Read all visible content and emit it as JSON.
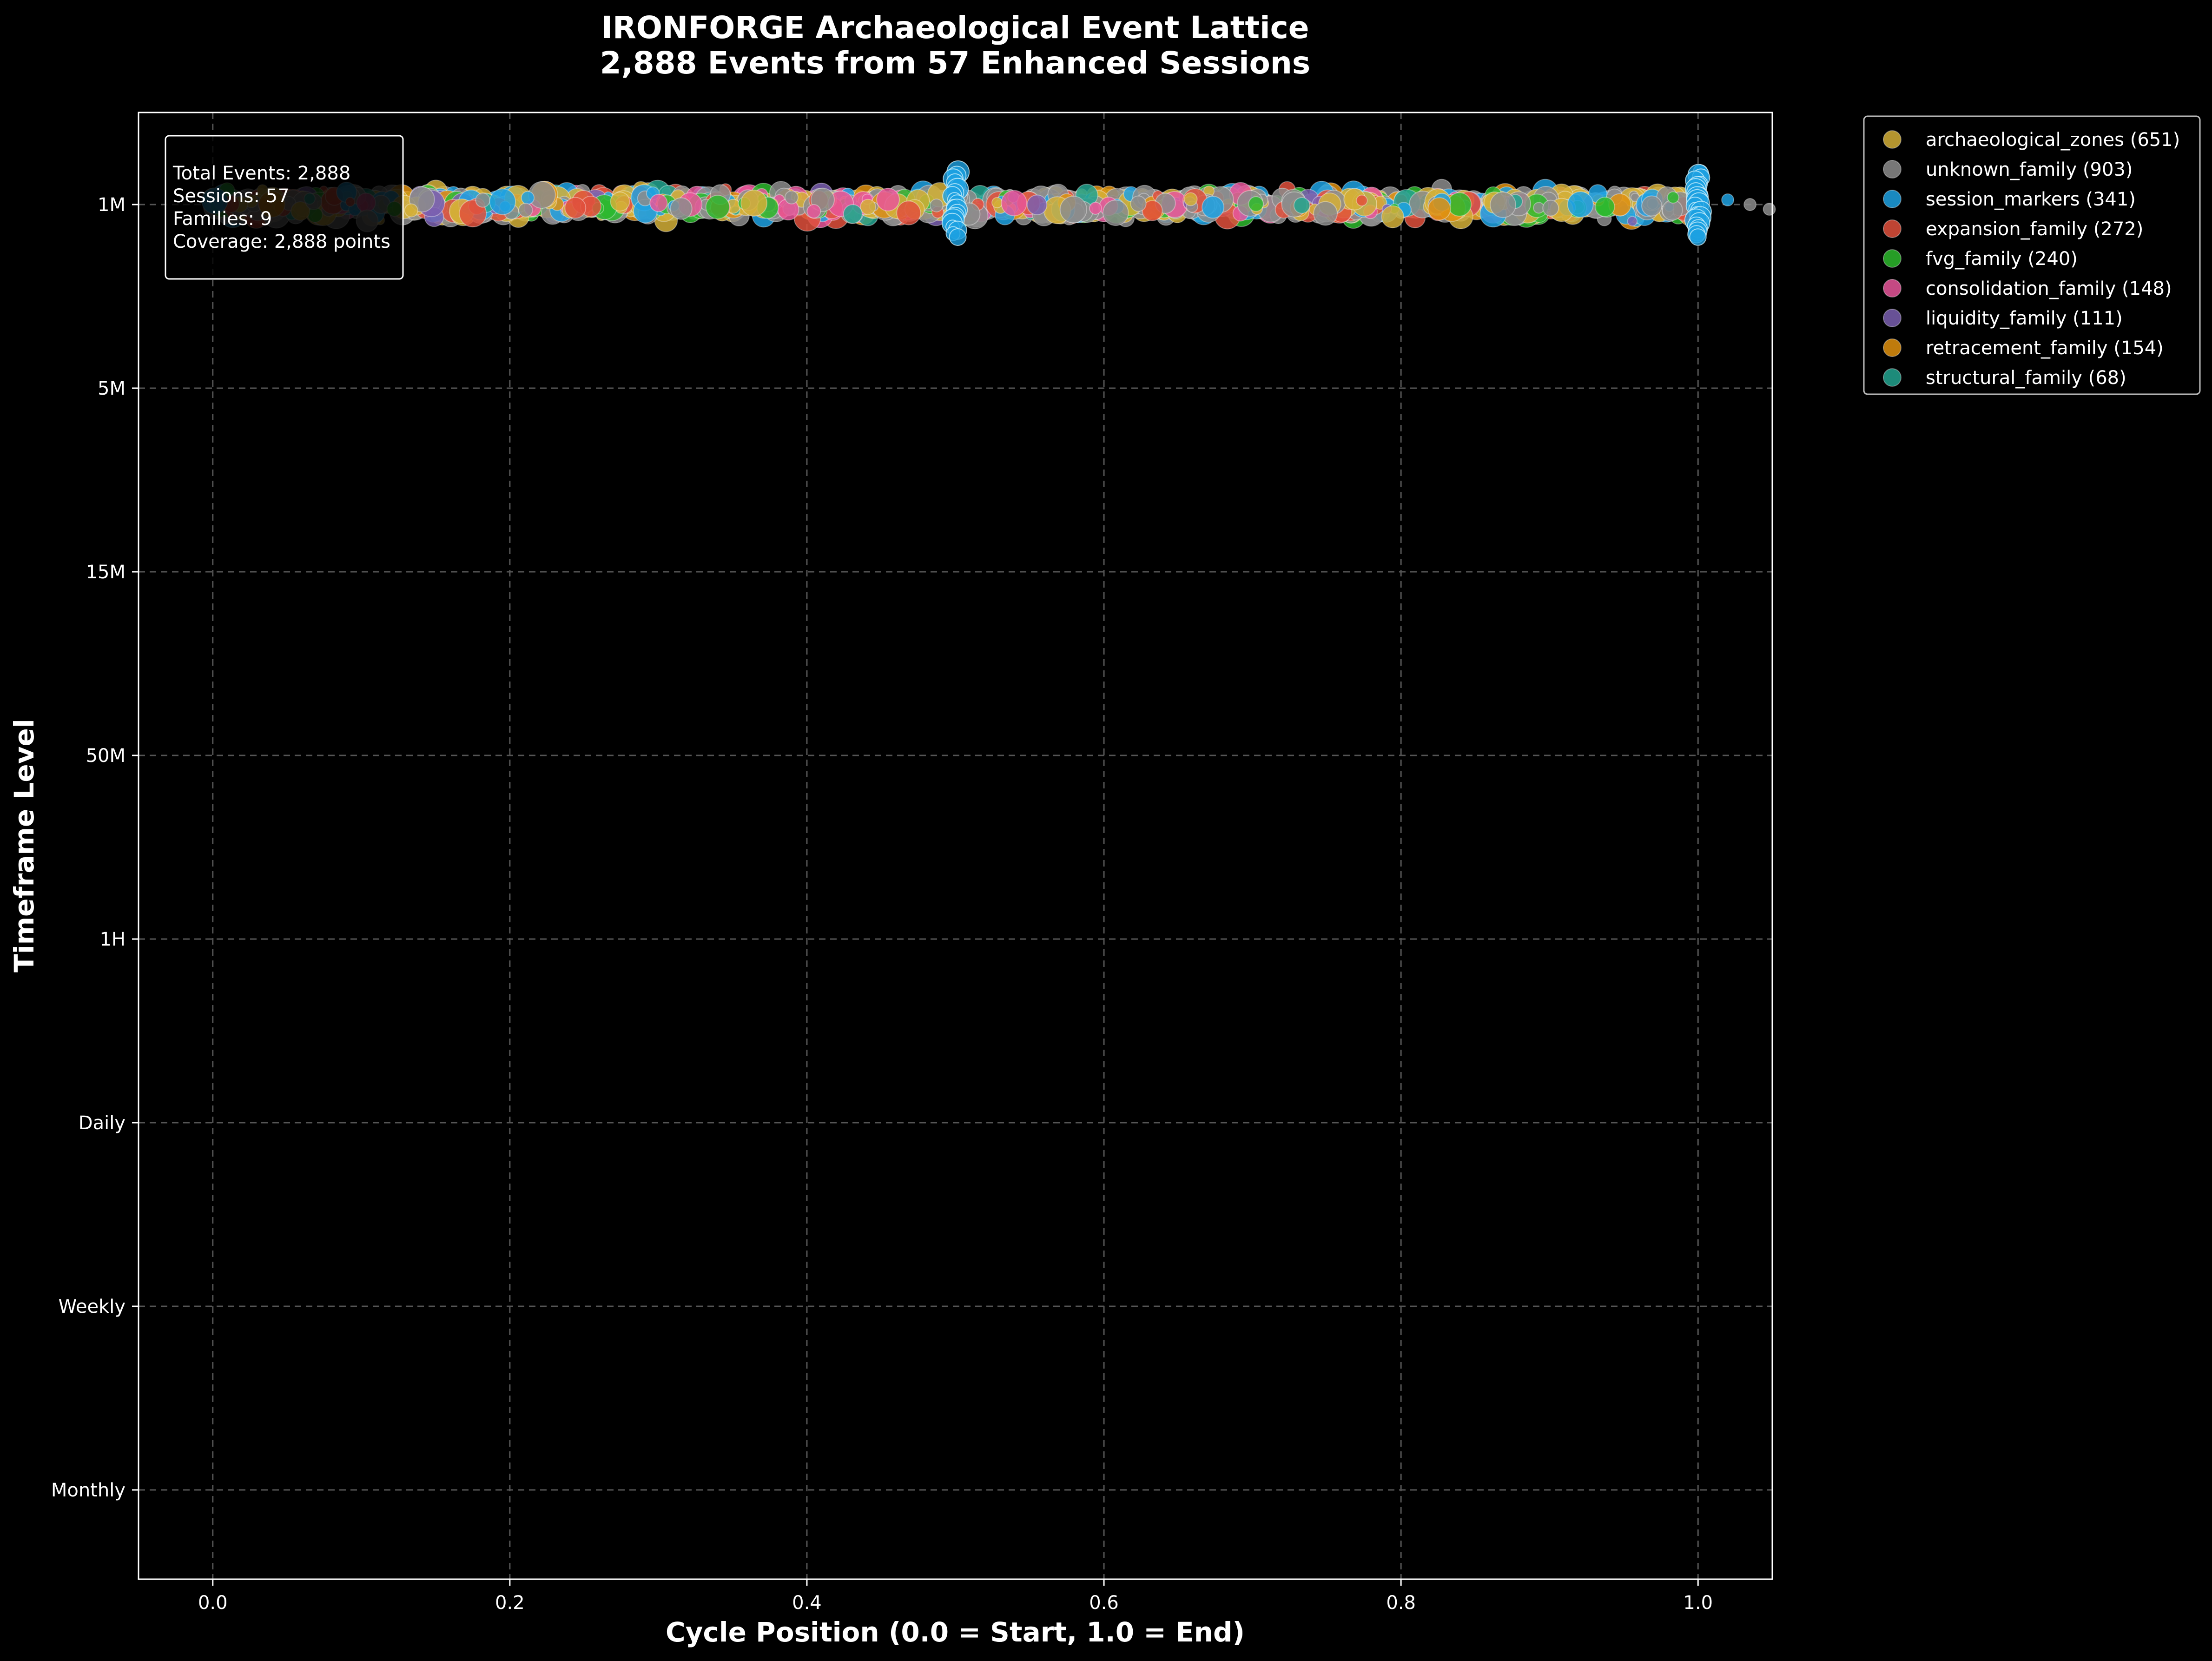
{
  "chart_data": {
    "type": "scatter",
    "title": "IRONFORGE Archaeological Event Lattice",
    "subtitle": "2,888 Events from 57 Enhanced Sessions",
    "xlabel": "Cycle Position (0.0 = Start, 1.0 = End)",
    "ylabel": "Timeframe Level",
    "xlim": [
      -0.05,
      1.05
    ],
    "x_ticks": [
      0.0,
      0.2,
      0.4,
      0.6,
      0.8,
      1.0
    ],
    "x_tick_labels": [
      "0.0",
      "0.2",
      "0.4",
      "0.6",
      "0.8",
      "1.0"
    ],
    "y_categories": [
      "1M",
      "5M",
      "15M",
      "50M",
      "1H",
      "Daily",
      "Weekly",
      "Monthly"
    ],
    "y_inverted": true,
    "grid": true,
    "legend_position": "outside-top-right",
    "info_box": {
      "lines": [
        "Total Events: 2,888",
        "Sessions: 57",
        "Families: 9",
        "Coverage: 2,888 points"
      ]
    },
    "series": [
      {
        "name": "archaeological_zones (651)",
        "count": 651,
        "color": "#d4af37"
      },
      {
        "name": "unknown_family (903)",
        "count": 903,
        "color": "#8c8c8c"
      },
      {
        "name": "session_markers (341)",
        "count": 341,
        "color": "#1da1e2"
      },
      {
        "name": "expansion_family (272)",
        "count": 272,
        "color": "#e0503c"
      },
      {
        "name": "fvg_family (240)",
        "count": 240,
        "color": "#2db82d"
      },
      {
        "name": "consolidation_family (148)",
        "count": 148,
        "color": "#e8569a"
      },
      {
        "name": "liquidity_family (111)",
        "count": 111,
        "color": "#7a5fb0"
      },
      {
        "name": "retracement_family (154)",
        "count": 154,
        "color": "#e0900e"
      },
      {
        "name": "structural_family (68)",
        "count": 68,
        "color": "#22a38f"
      }
    ],
    "distribution": {
      "y_category": "1M",
      "x_range": [
        0.0,
        1.05
      ],
      "clusters": [
        {
          "x": 0.5,
          "series": "session_markers (341)",
          "count": 20
        },
        {
          "x": 1.0,
          "series": "session_markers (341)",
          "count": 24
        }
      ]
    }
  }
}
